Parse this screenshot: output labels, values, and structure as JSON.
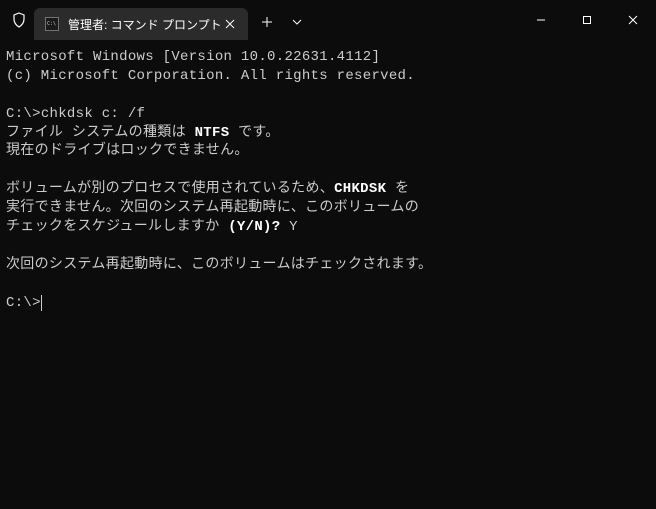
{
  "titlebar": {
    "tab_title": "管理者: コマンド プロンプト"
  },
  "terminal": {
    "line1": "Microsoft Windows [Version 10.0.22631.4112]",
    "line2": "(c) Microsoft Corporation. All rights reserved.",
    "prompt1": "C:\\>",
    "command1": "chkdsk c: /f",
    "fs_line_pre": "ファイル システムの種類は ",
    "fs_type": "NTFS",
    "fs_line_post": " です。",
    "lock_line": "現在のドライブはロックできません。",
    "busy_pre": "ボリュームが別のプロセスで使用されているため、",
    "busy_hl": "CHKDSK",
    "busy_post": " を",
    "sched1": "実行できません。次回のシステム再起動時に、このボリュームの",
    "sched2_pre": "チェックをスケジュールしますか ",
    "sched2_q": "(Y/N)?",
    "sched2_ans": " Y",
    "confirm": "次回のシステム再起動時に、このボリュームはチェックされます。",
    "prompt2": "C:\\>"
  }
}
